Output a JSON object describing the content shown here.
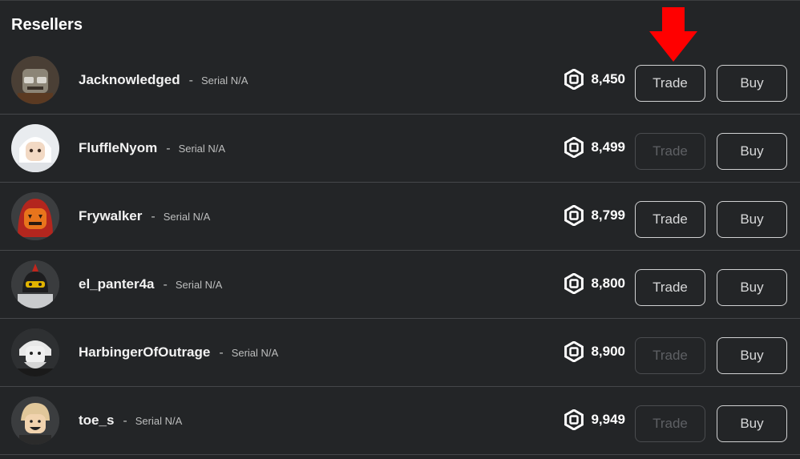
{
  "section": {
    "title": "Resellers"
  },
  "colors": {
    "background": "#232527",
    "arrow": "#ff0000",
    "text": "#ffffff",
    "muted": "#bdbebe"
  },
  "annotation": {
    "icon": "red-down-arrow-icon"
  },
  "currency_icon": "robux-icon",
  "resellers": [
    {
      "username": "Jacknowledged",
      "dash": "-",
      "serial": "Serial N/A",
      "price": "8,450",
      "trade_label": "Trade",
      "trade_enabled": true,
      "buy_label": "Buy",
      "avatar_icon": "avatar-icon"
    },
    {
      "username": "FluffleNyom",
      "dash": "-",
      "serial": "Serial N/A",
      "price": "8,499",
      "trade_label": "Trade",
      "trade_enabled": false,
      "buy_label": "Buy",
      "avatar_icon": "avatar-icon"
    },
    {
      "username": "Frywalker",
      "dash": "-",
      "serial": "Serial N/A",
      "price": "8,799",
      "trade_label": "Trade",
      "trade_enabled": true,
      "buy_label": "Buy",
      "avatar_icon": "avatar-icon"
    },
    {
      "username": "el_panter4a",
      "dash": "-",
      "serial": "Serial N/A",
      "price": "8,800",
      "trade_label": "Trade",
      "trade_enabled": true,
      "buy_label": "Buy",
      "avatar_icon": "avatar-icon"
    },
    {
      "username": "HarbingerOfOutrage",
      "dash": "-",
      "serial": "Serial N/A",
      "price": "8,900",
      "trade_label": "Trade",
      "trade_enabled": false,
      "buy_label": "Buy",
      "avatar_icon": "avatar-icon"
    },
    {
      "username": "toe_s",
      "dash": "-",
      "serial": "Serial N/A",
      "price": "9,949",
      "trade_label": "Trade",
      "trade_enabled": false,
      "buy_label": "Buy",
      "avatar_icon": "avatar-icon"
    }
  ]
}
